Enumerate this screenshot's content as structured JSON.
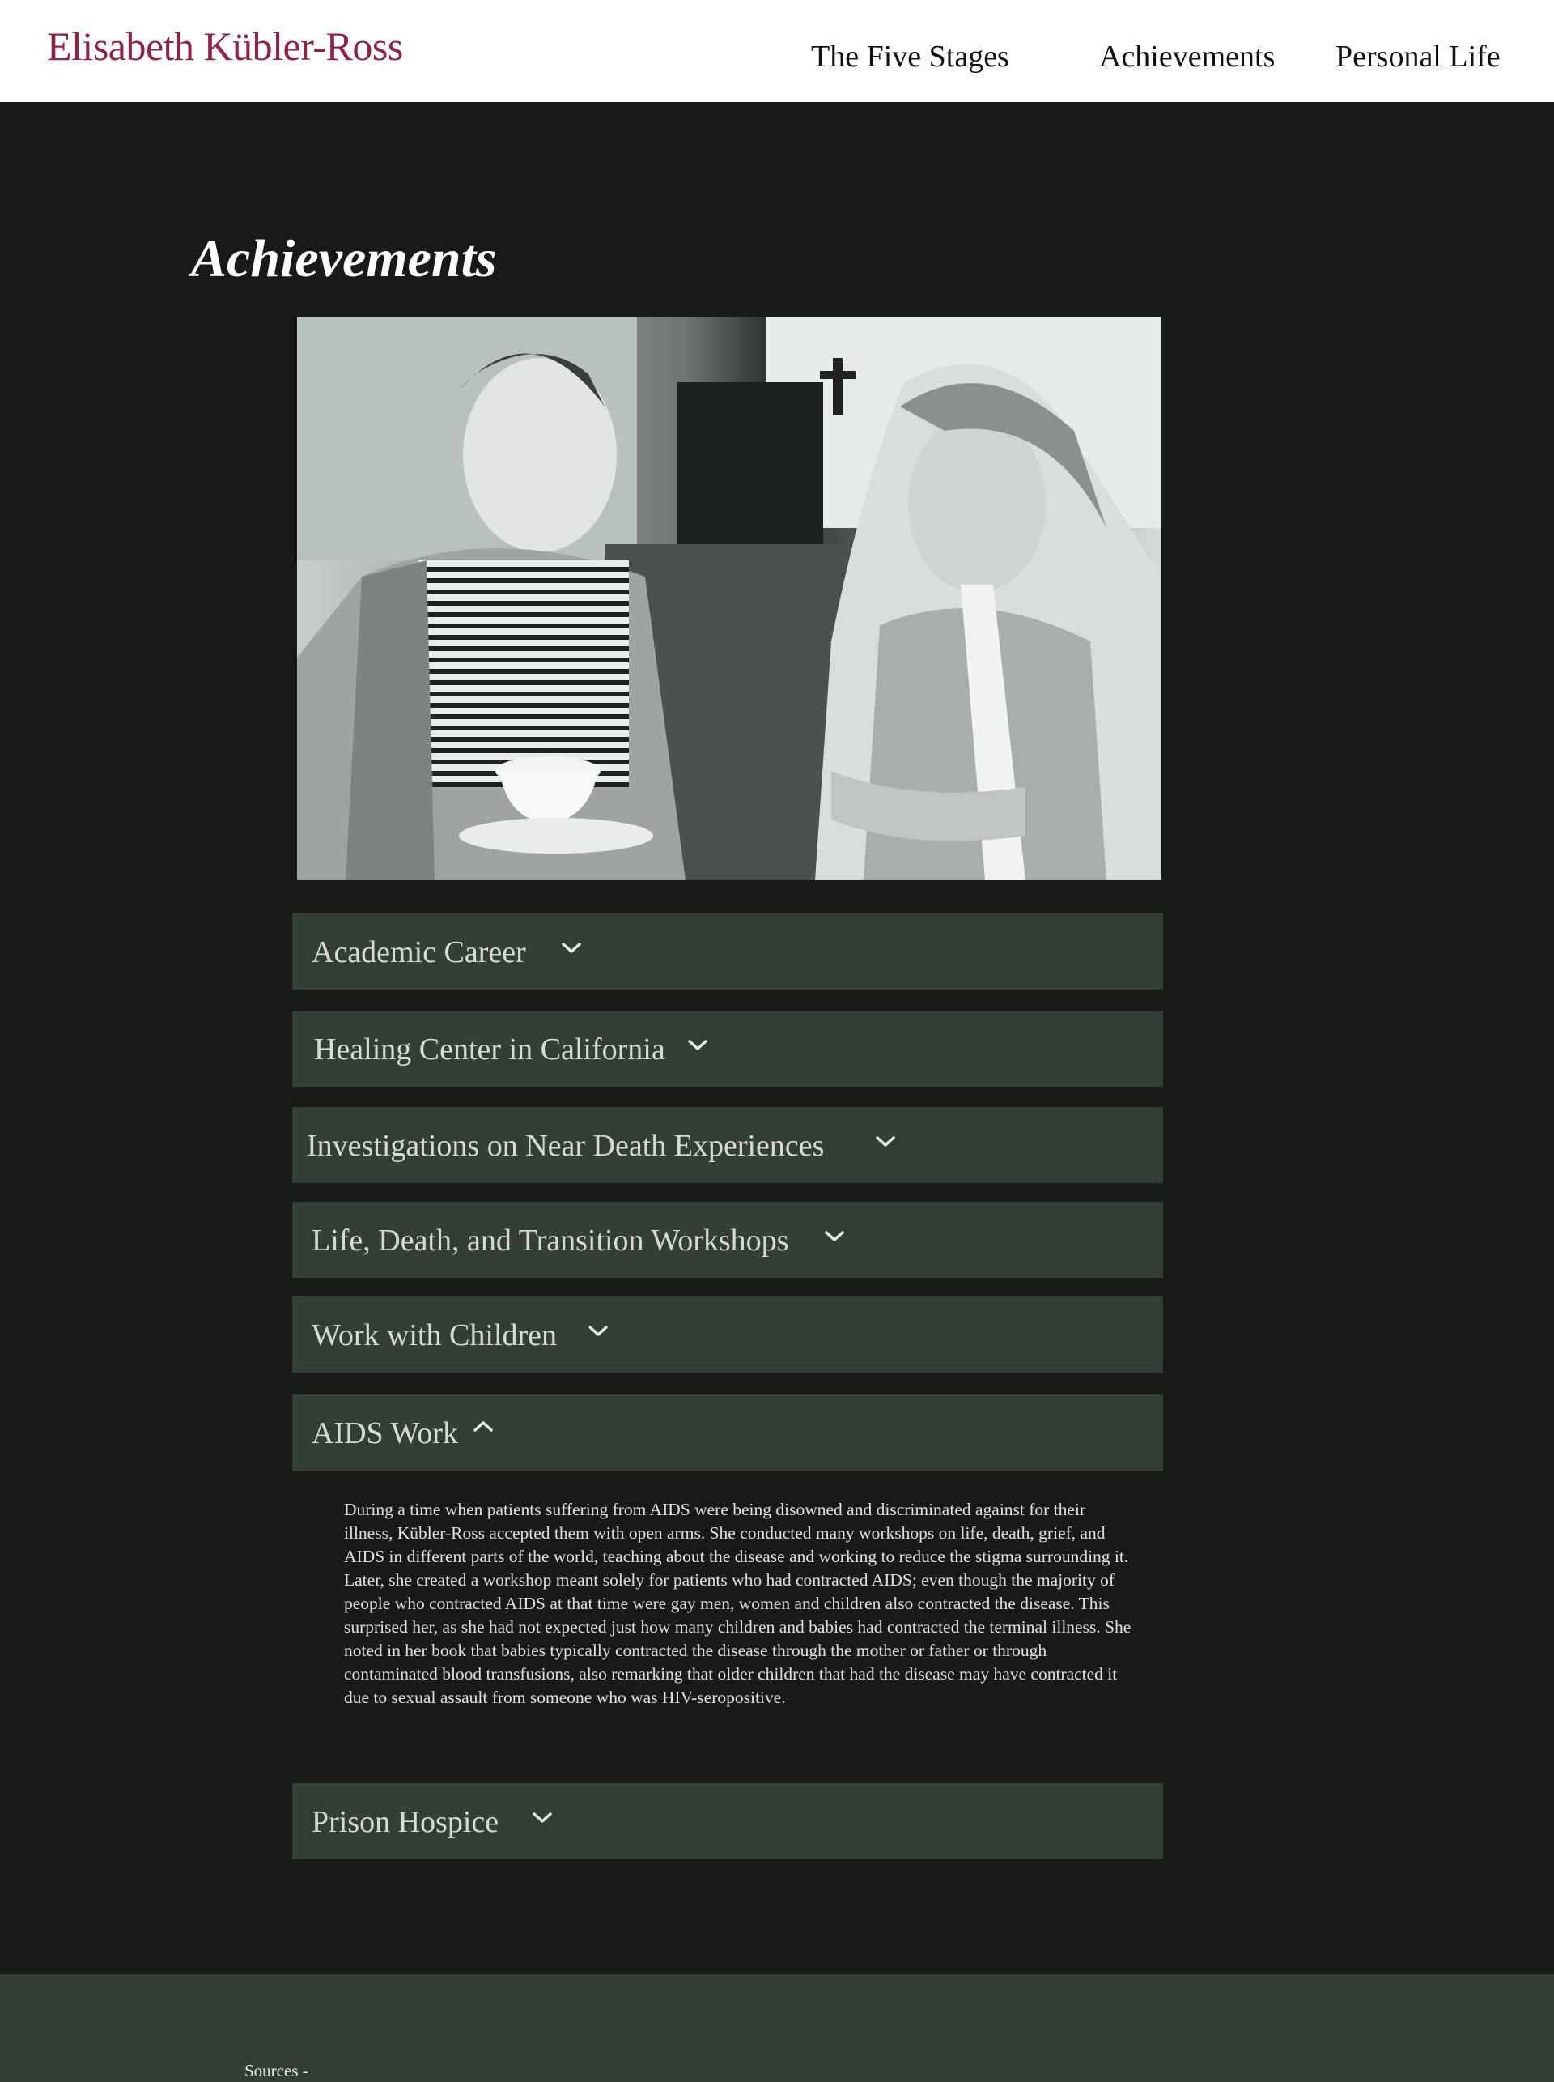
{
  "header": {
    "brand": "Elisabeth Kübler-Ross",
    "nav": [
      "The Five Stages",
      "Achievements",
      "Personal Life"
    ]
  },
  "main": {
    "title": "Achievements",
    "photo_alt": "Black-and-white photo of two women smiling at each other, one holding a teacup",
    "accordion": [
      {
        "label": "Academic Career",
        "expanded": false
      },
      {
        "label": "Healing Center in California",
        "expanded": false
      },
      {
        "label": "Investigations on Near Death Experiences",
        "expanded": false
      },
      {
        "label": "Life, Death, and Transition Workshops",
        "expanded": false
      },
      {
        "label": "Work with Children",
        "expanded": false
      },
      {
        "label": "AIDS Work",
        "expanded": true,
        "body": "During a time when patients suffering from AIDS were being disowned and discriminated against for their illness, Kübler-Ross accepted them with open arms. She conducted many workshops on life, death, grief, and AIDS in different parts of the world, teaching about the disease and working to reduce the stigma surrounding it. Later, she created a workshop meant solely for patients who had contracted AIDS; even though the majority of people who contracted AIDS at that time were gay men, women and children also contracted the disease. This surprised her, as she had not expected just how many children and babies had contracted the terminal illness. She noted in her book that babies typically contracted the disease through the mother or father or through contaminated blood transfusions, also remarking that older children that had the disease may have contracted it due to sexual assault from someone who was HIV-seropositive."
      },
      {
        "label": "Prison Hospice",
        "expanded": false
      }
    ]
  },
  "footer": {
    "sources_label": "Sources -"
  },
  "colors": {
    "brand": "#8e2548",
    "page_bg": "#181a18",
    "panel_bg": "#333e37",
    "footer_bg": "#323d35"
  }
}
